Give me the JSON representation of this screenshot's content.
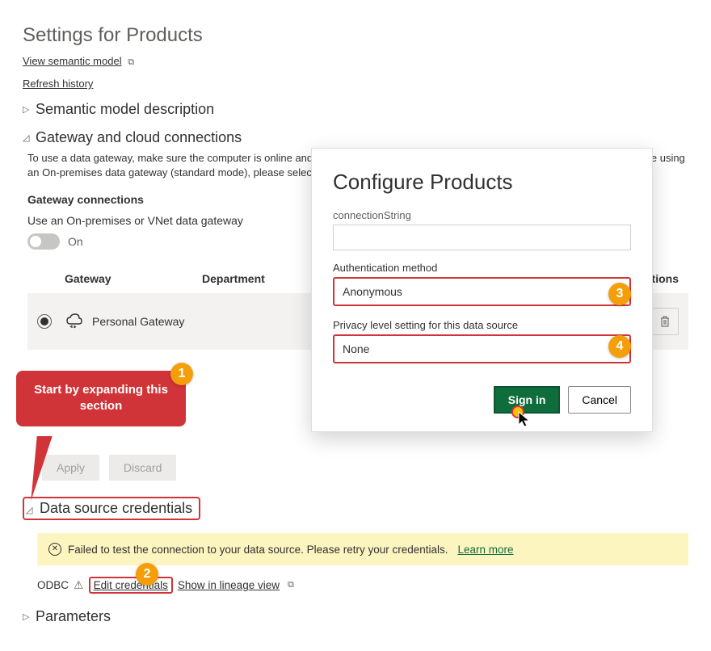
{
  "page": {
    "title": "Settings for Products",
    "view_model_link": "View semantic model",
    "refresh_link": "Refresh history"
  },
  "sections": {
    "semantic": {
      "label": "Semantic model description"
    },
    "gateway": {
      "label": "Gateway and cloud connections",
      "help": "To use a data gateway, make sure the computer is online and the data source is added in Manage Connections and Gateways. If you're using an On-premises data gateway (standard mode), please select the corresponding data sources and then click apply.",
      "sub": "Gateway connections",
      "toggle_label": "Use an On-premises or VNet data gateway",
      "toggle_state": "On",
      "cols": {
        "gateway": "Gateway",
        "department": "Department",
        "actions": "Actions"
      },
      "row": {
        "name": "Personal Gateway"
      },
      "apply": "Apply",
      "discard": "Discard"
    },
    "datasource": {
      "label": "Data source credentials",
      "error": "Failed to test the connection to your data source. Please retry your credentials.",
      "learn": "Learn more",
      "type": "ODBC",
      "edit": "Edit credentials",
      "lineage": "Show in lineage view"
    },
    "params": {
      "label": "Parameters"
    }
  },
  "modal": {
    "title": "Configure Products",
    "conn_label": "connectionString",
    "auth_label": "Authentication method",
    "auth_value": "Anonymous",
    "priv_label": "Privacy level setting for this data source",
    "priv_value": "None",
    "signin": "Sign in",
    "cancel": "Cancel"
  },
  "callout": {
    "text": "Start by expanding this section"
  },
  "badges": {
    "1": "1",
    "2": "2",
    "3": "3",
    "4": "4"
  }
}
